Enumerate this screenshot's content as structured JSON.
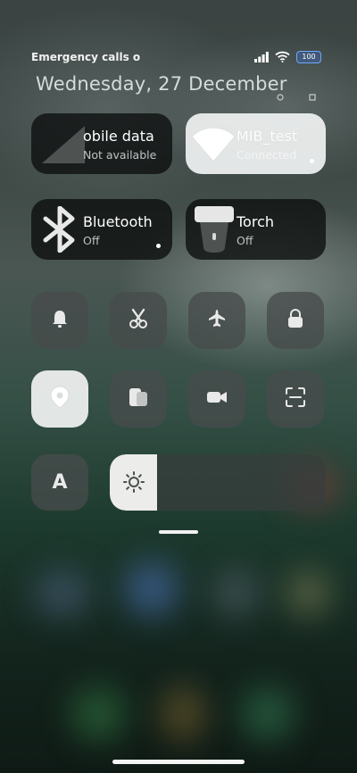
{
  "status_bar": {
    "carrier_text": "Emergency calls o",
    "battery_level": "100"
  },
  "date_text": "Wednesday, 27 December",
  "tiles": {
    "mobile_data": {
      "title": "obile data",
      "subtitle": "Not available"
    },
    "wifi": {
      "title": "MIB_test",
      "subtitle": "Connected"
    },
    "bluetooth": {
      "title": "Bluetooth",
      "subtitle": "Off"
    },
    "torch": {
      "title": "Torch",
      "subtitle": "Off"
    }
  },
  "toggles_row1": [
    "bell-icon",
    "scissors-icon",
    "airplane-icon",
    "lock-icon"
  ],
  "toggles_row2": [
    "location-icon",
    "cards-icon",
    "video-camera-icon",
    "scan-icon"
  ],
  "font_button_label": "A",
  "colors": {
    "accent_battery": "#6ea8ff",
    "tile_dark": "#0c0e0e",
    "tile_light": "#eceeee"
  }
}
